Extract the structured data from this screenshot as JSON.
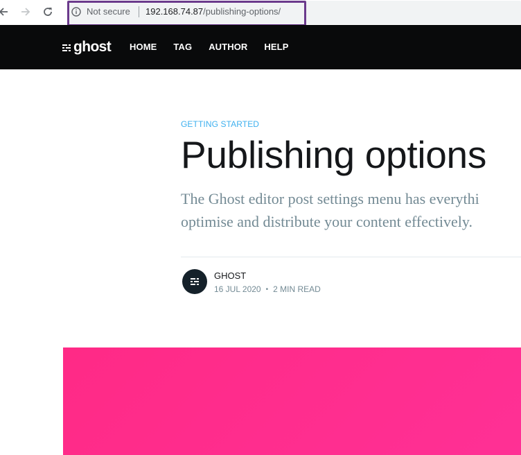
{
  "browser": {
    "security_label": "Not secure",
    "url_host": "192.168.74.87",
    "url_path": "/publishing-options/"
  },
  "site": {
    "logo_text": "ghost",
    "nav": [
      {
        "label": "HOME"
      },
      {
        "label": "TAG"
      },
      {
        "label": "AUTHOR"
      },
      {
        "label": "HELP"
      }
    ]
  },
  "post": {
    "tag": "GETTING STARTED",
    "title": "Publishing options",
    "excerpt_line1": "The Ghost editor post settings menu has everythi",
    "excerpt_line2": "optimise and distribute your content effectively.",
    "author": "GHOST",
    "date": "16 JUL 2020",
    "reading_time": "2 MIN READ",
    "meta_separator": "•"
  },
  "colors": {
    "header_bg": "#090a0b",
    "tag_color": "#3eb0ef",
    "feature_image": "#ff2d8e",
    "highlight_border": "#6b3a8c"
  }
}
